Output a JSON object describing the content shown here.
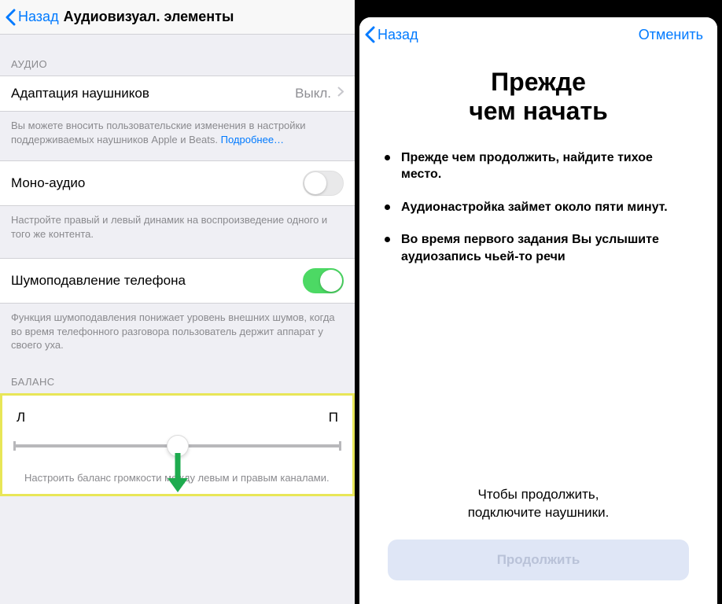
{
  "left": {
    "nav": {
      "back": "Назад",
      "title": "Аудиовизуал. элементы"
    },
    "audio_section": "АУДИО",
    "headphone_cell": {
      "label": "Адаптация наушников",
      "value": "Выкл."
    },
    "headphone_footer": "Вы можете вносить пользовательские изменения в настройки поддерживаемых наушников Apple и Beats.",
    "more_link": "Подробнее…",
    "mono_label": "Моно-аудио",
    "mono_footer": "Настройте правый и левый динамик на воспроизведение одного и того же контента.",
    "noise_label": "Шумоподавление телефона",
    "noise_footer": "Функция шумоподавления понижает уровень внешних шумов, когда во время телефонного разговора пользователь держит аппарат у своего уха.",
    "balance_section": "БАЛАНС",
    "balance_left": "Л",
    "balance_right": "П",
    "balance_footer": "Настроить баланс громкости между левым и правым каналами."
  },
  "right": {
    "nav": {
      "back": "Назад",
      "cancel": "Отменить"
    },
    "title": "Прежде\nчем начать",
    "bullets": [
      "Прежде чем продолжить, найдите тихое место.",
      "Аудионастройка займет около пяти минут.",
      "Во время первого задания Вы услышите аудиозапись чьей-то речи"
    ],
    "connect_hint": "Чтобы продолжить,\nподключите наушники.",
    "continue_label": "Продолжить"
  },
  "colors": {
    "accent": "#007aff",
    "switch_on": "#4cd964",
    "highlight": "#e8e657",
    "arrow": "#1eab4f"
  }
}
